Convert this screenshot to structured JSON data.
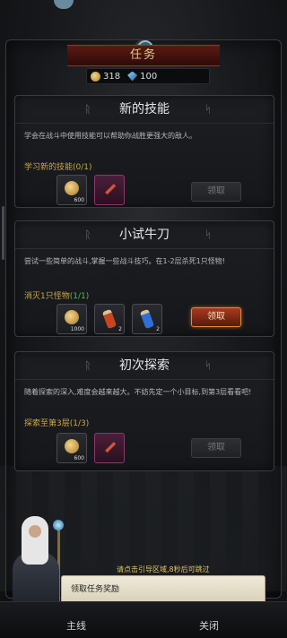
{
  "header": {
    "title": "任务"
  },
  "currency": {
    "gold": "318",
    "gems": "100"
  },
  "quests": [
    {
      "title": "新的技能",
      "description": "学会在战斗中使用技能可以帮助你战胜更强大的敌人。",
      "objective": "学习新的技能",
      "progress": "(0/1)",
      "rewards": [
        {
          "icon": "coin-icon",
          "count": "600"
        },
        {
          "icon": "skill-scroll-icon",
          "count": ""
        }
      ],
      "claim_label": "领取",
      "claimable": false
    },
    {
      "title": "小试牛刀",
      "description": "尝试一些简单的战斗,掌握一些战斗技巧。在1-2层杀死1只怪物!",
      "objective": "消灭1只怪物",
      "progress": "(1/1)",
      "rewards": [
        {
          "icon": "coin-icon",
          "count": "1000"
        },
        {
          "icon": "red-potion-icon",
          "count": "2"
        },
        {
          "icon": "blue-potion-icon",
          "count": "2"
        }
      ],
      "claim_label": "领取",
      "claimable": true
    },
    {
      "title": "初次探索",
      "description": "随着探索的深入,难度会越来越大。不妨先定一个小目标,到第3层看看吧!",
      "objective": "探索至第3层",
      "progress": "(1/3)",
      "rewards": [
        {
          "icon": "coin-icon",
          "count": "600"
        },
        {
          "icon": "skill-scroll-icon",
          "count": ""
        }
      ],
      "claim_label": "领取",
      "claimable": false
    }
  ],
  "guide": {
    "hint": "请点击引导区域,8秒后可跳过",
    "dialog": "领取任务奖励"
  },
  "nav": {
    "main": "主线",
    "close": "关闭"
  }
}
